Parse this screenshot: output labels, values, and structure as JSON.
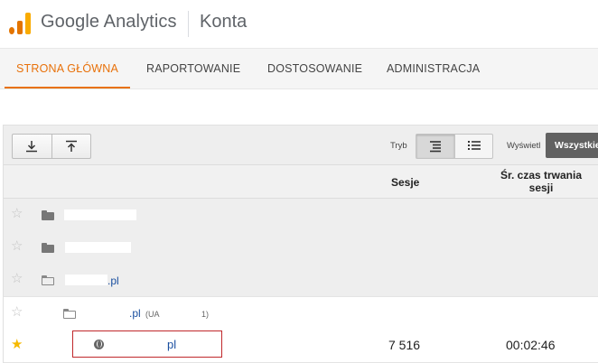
{
  "header": {
    "brand": "Google Analytics",
    "title": "Konta"
  },
  "nav": {
    "tabs": [
      {
        "label": "STRONA GŁÓWNA",
        "active": true
      },
      {
        "label": "RAPORTOWANIE",
        "active": false
      },
      {
        "label": "DOSTOSOWANIE",
        "active": false
      },
      {
        "label": "ADMINISTRACJA",
        "active": false
      }
    ]
  },
  "toolbar": {
    "tryb_label": "Tryb",
    "wyswietl_label": "Wyświetl",
    "filter_value": "Wszystkie",
    "icons": [
      "download-icon",
      "upload-icon",
      "hierarchy-view-icon",
      "list-view-icon"
    ]
  },
  "table": {
    "columns": {
      "sessions": "Sesje",
      "avg_duration": "Śr. czas trwania sesji"
    },
    "rows": [
      {
        "type": "account",
        "name_suffix": "",
        "starred": false
      },
      {
        "type": "account",
        "name_suffix": "",
        "starred": false
      },
      {
        "type": "account",
        "name_suffix": ".pl",
        "starred": false
      },
      {
        "type": "property",
        "name_suffix": ".pl",
        "ua_prefix": "(UA",
        "ua_suffix": "1)",
        "starred": false
      },
      {
        "type": "view",
        "name_suffix": "pl",
        "starred": true,
        "sessions": "7 516",
        "avg_duration": "00:02:46"
      }
    ]
  },
  "colors": {
    "accent": "#e8710a",
    "star_filled": "#f6b900",
    "link": "#1a4fa0",
    "highlight_border": "#c0282b"
  }
}
